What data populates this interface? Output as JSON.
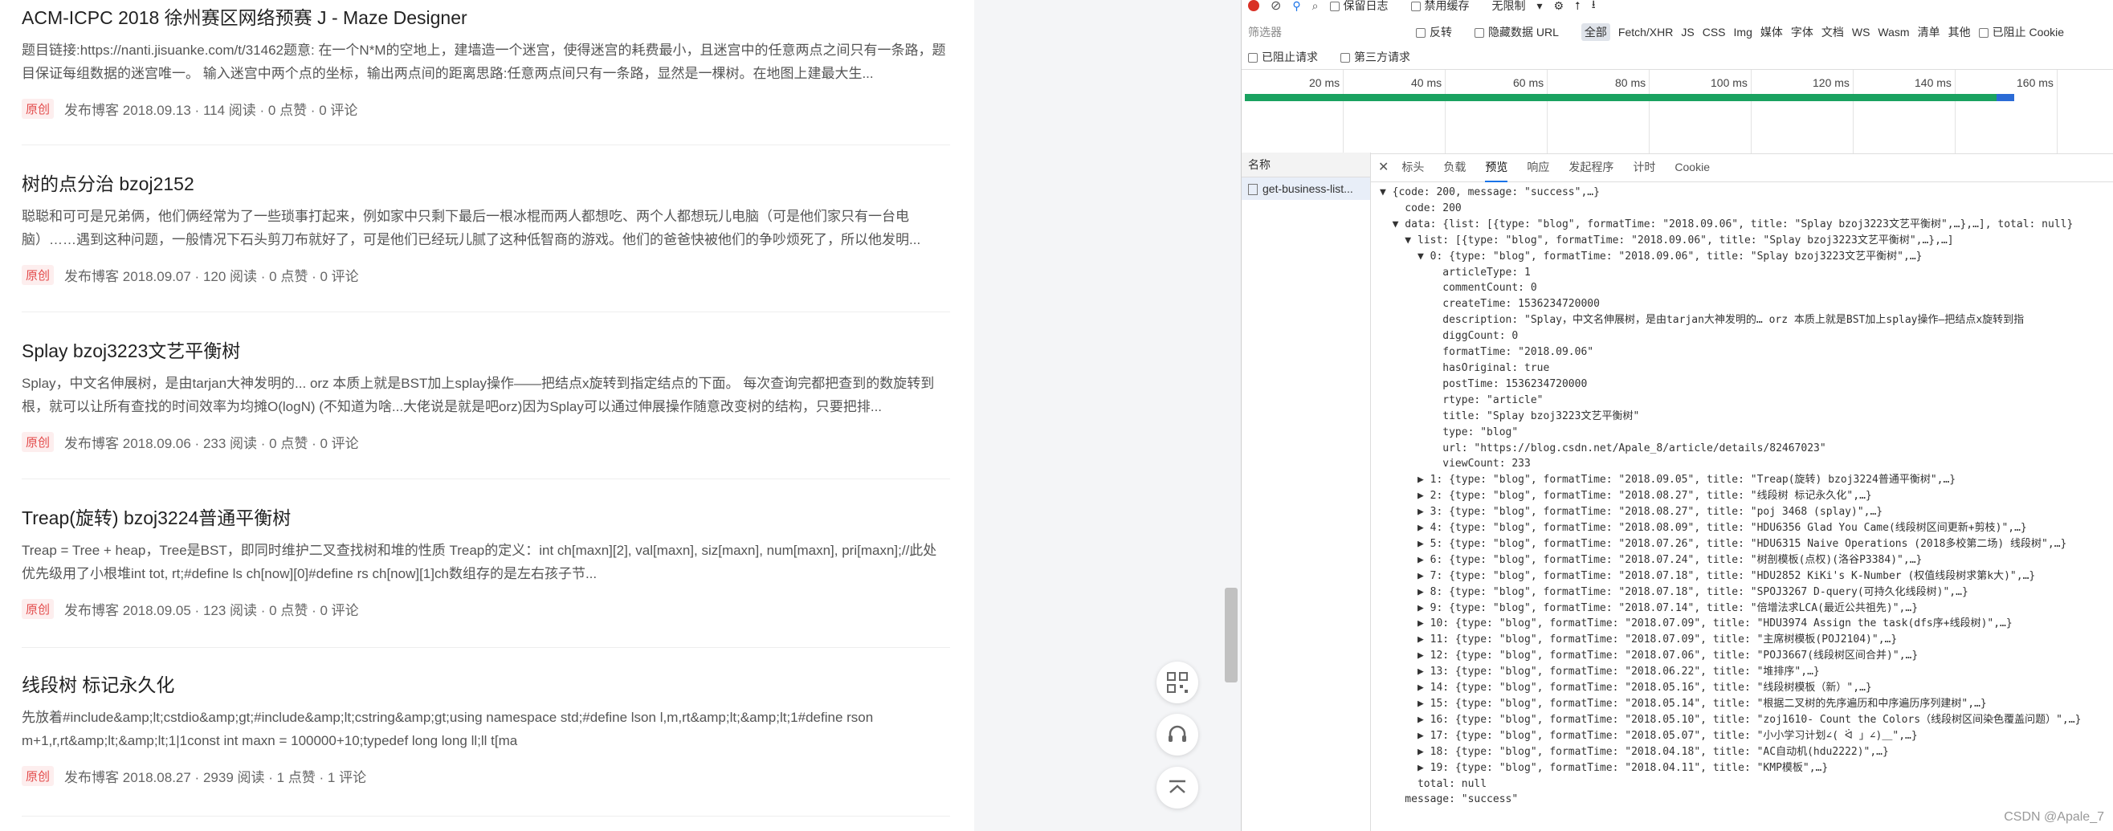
{
  "blog": {
    "articles": [
      {
        "title": "ACM-ICPC 2018 徐州赛区网络预赛 J - Maze Designer",
        "desc": "题目链接:https://nanti.jisuanke.com/t/31462题意: 在一个N*M的空地上，建墙造一个迷宫，使得迷宫的耗费最小，且迷宫中的任意两点之间只有一条路，题目保证每组数据的迷宫唯一。 输入迷宫中两个点的坐标，输出两点间的距离思路:任意两点间只有一条路，显然是一棵树。在地图上建最大生...",
        "badge": "原创",
        "date": "发布博客 2018.09.13 ·",
        "views": "114 阅读 ·",
        "likes": "0 点赞 ·",
        "comments": "0 评论"
      },
      {
        "title": "树的点分治 bzoj2152",
        "desc": "聪聪和可可是兄弟俩，他们俩经常为了一些琐事打起来，例如家中只剩下最后一根冰棍而两人都想吃、两个人都想玩儿电脑（可是他们家只有一台电脑）……遇到这种问题，一般情况下石头剪刀布就好了，可是他们已经玩儿腻了这种低智商的游戏。他们的爸爸快被他们的争吵烦死了，所以他发明...",
        "badge": "原创",
        "date": "发布博客 2018.09.07 ·",
        "views": "120 阅读 ·",
        "likes": "0 点赞 ·",
        "comments": "0 评论"
      },
      {
        "title": "Splay bzoj3223文艺平衡树",
        "desc": "Splay，中文名伸展树，是由tarjan大神发明的... orz 本质上就是BST加上splay操作——把结点x旋转到指定结点的下面。 每次查询完都把查到的数旋转到根，就可以让所有查找的时间效率为均摊O(logN) (不知道为啥...大佬说是就是吧orz)因为Splay可以通过伸展操作随意改变树的结构，只要把排...",
        "badge": "原创",
        "date": "发布博客 2018.09.06 ·",
        "views": "233 阅读 ·",
        "likes": "0 点赞 ·",
        "comments": "0 评论"
      },
      {
        "title": "Treap(旋转) bzoj3224普通平衡树",
        "desc": "Treap = Tree + heap，Tree是BST，即同时维护二叉查找树和堆的性质 Treap的定义：int ch[maxn][2], val[maxn], siz[maxn], num[maxn], pri[maxn];//此处优先级用了小根堆int tot, rt;#define ls ch[now][0]#define rs ch[now][1]ch数组存的是左右孩子节...",
        "badge": "原创",
        "date": "发布博客 2018.09.05 ·",
        "views": "123 阅读 ·",
        "likes": "0 点赞 ·",
        "comments": "0 评论"
      },
      {
        "title": "线段树 标记永久化",
        "desc": "先放着#include&amp;lt;cstdio&amp;gt;#include&amp;lt;cstring&amp;gt;using namespace std;#define lson l,m,rt&amp;lt;&amp;lt;1#define rson m+1,r,rt&amp;lt;&amp;lt;1|1const int maxn = 100000+10;typedef long long ll;ll t[ma",
        "badge": "原创",
        "date": "发布博客 2018.08.27 ·",
        "views": "2939 阅读 ·",
        "likes": "1 点赞 ·",
        "comments": "1 评论"
      }
    ]
  },
  "devtools": {
    "toolbar1": {
      "preserve_log": "保留日志",
      "disable_cache": "禁用缓存",
      "throttle": "无限制"
    },
    "toolbar2": {
      "filter_placeholder": "筛选器",
      "invert": "反转",
      "hide_data_url": "隐藏数据 URL",
      "all": "全部",
      "types": [
        "Fetch/XHR",
        "JS",
        "CSS",
        "Img",
        "媒体",
        "字体",
        "文档",
        "WS",
        "Wasm",
        "清单",
        "其他"
      ],
      "block_cookies": "已阻止 Cookie"
    },
    "toolbar3": {
      "blocked_requests": "已阻止请求",
      "third_party": "第三方请求"
    },
    "timeline_ticks": [
      "20 ms",
      "40 ms",
      "60 ms",
      "80 ms",
      "100 ms",
      "120 ms",
      "140 ms",
      "160 ms"
    ],
    "name_header": "名称",
    "request_name": "get-business-list...",
    "tabs": [
      "标头",
      "负载",
      "预览",
      "响应",
      "发起程序",
      "计时",
      "Cookie"
    ],
    "active_tab": "预览",
    "json_lines": [
      "▼ {code: 200, message: \"success\",…}",
      "    code: 200",
      "  ▼ data: {list: [{type: \"blog\", formatTime: \"2018.09.06\", title: \"Splay bzoj3223文艺平衡树\",…},…], total: null}",
      "    ▼ list: [{type: \"blog\", formatTime: \"2018.09.06\", title: \"Splay bzoj3223文艺平衡树\",…},…]",
      "      ▼ 0: {type: \"blog\", formatTime: \"2018.09.06\", title: \"Splay bzoj3223文艺平衡树\",…}",
      "          articleType: 1",
      "          commentCount: 0",
      "          createTime: 1536234720000",
      "          description: \"Splay，中文名伸展树，是由tarjan大神发明的… orz 本质上就是BST加上splay操作—把结点x旋转到指",
      "          diggCount: 0",
      "          formatTime: \"2018.09.06\"",
      "          hasOriginal: true",
      "          postTime: 1536234720000",
      "          rtype: \"article\"",
      "          title: \"Splay bzoj3223文艺平衡树\"",
      "          type: \"blog\"",
      "          url: \"https://blog.csdn.net/Apale_8/article/details/82467023\"",
      "          viewCount: 233",
      "      ▶ 1: {type: \"blog\", formatTime: \"2018.09.05\", title: \"Treap(旋转) bzoj3224普通平衡树\",…}",
      "      ▶ 2: {type: \"blog\", formatTime: \"2018.08.27\", title: \"线段树 标记永久化\",…}",
      "      ▶ 3: {type: \"blog\", formatTime: \"2018.08.27\", title: \"poj 3468 (splay)\",…}",
      "      ▶ 4: {type: \"blog\", formatTime: \"2018.08.09\", title: \"HDU6356 Glad You Came(线段树区间更新+剪枝)\",…}",
      "      ▶ 5: {type: \"blog\", formatTime: \"2018.07.26\", title: \"HDU6315 Naive Operations (2018多校第二场) 线段树\",…}",
      "      ▶ 6: {type: \"blog\", formatTime: \"2018.07.24\", title: \"树剖模板(点权)(洛谷P3384)\",…}",
      "      ▶ 7: {type: \"blog\", formatTime: \"2018.07.18\", title: \"HDU2852 KiKi's K-Number (权值线段树求第k大)\",…}",
      "      ▶ 8: {type: \"blog\", formatTime: \"2018.07.18\", title: \"SPOJ3267 D-query(可持久化线段树)\",…}",
      "      ▶ 9: {type: \"blog\", formatTime: \"2018.07.14\", title: \"倍增法求LCA(最近公共祖先)\",…}",
      "      ▶ 10: {type: \"blog\", formatTime: \"2018.07.09\", title: \"HDU3974 Assign the task(dfs序+线段树)\",…}",
      "      ▶ 11: {type: \"blog\", formatTime: \"2018.07.09\", title: \"主席树模板(POJ2104)\",…}",
      "      ▶ 12: {type: \"blog\", formatTime: \"2018.07.06\", title: \"POJ3667(线段树区间合并)\",…}",
      "      ▶ 13: {type: \"blog\", formatTime: \"2018.06.22\", title: \"堆排序\",…}",
      "      ▶ 14: {type: \"blog\", formatTime: \"2018.05.16\", title: \"线段树模板（新）\",…}",
      "      ▶ 15: {type: \"blog\", formatTime: \"2018.05.14\", title: \"根据二叉树的先序遍历和中序遍历序列建树\",…}",
      "      ▶ 16: {type: \"blog\", formatTime: \"2018.05.10\", title: \"zoj1610- Count the Colors（线段树区间染色覆盖问题）\",…}",
      "      ▶ 17: {type: \"blog\", formatTime: \"2018.05.07\", title: \"小小学习计划∠( ᐛ 」∠)＿\",…}",
      "      ▶ 18: {type: \"blog\", formatTime: \"2018.04.18\", title: \"AC自动机(hdu2222)\",…}",
      "      ▶ 19: {type: \"blog\", formatTime: \"2018.04.11\", title: \"KMP模板\",…}",
      "      total: null",
      "    message: \"success\""
    ],
    "watermark": "CSDN @Apale_7"
  }
}
